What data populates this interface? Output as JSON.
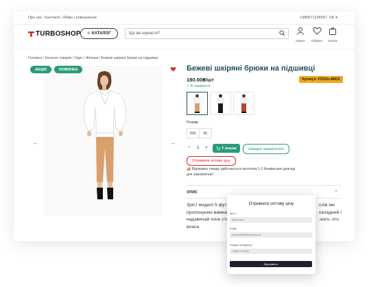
{
  "topbar": {
    "links": [
      "Про нас",
      "Контакти",
      "Обмін і повернення"
    ],
    "phone": "+380671234567",
    "lang": "UK"
  },
  "header": {
    "logo": "TURBOSHOP",
    "catalog_label": "КАТАЛОГ",
    "search_placeholder": "Що ви шукаєте?",
    "icons": [
      {
        "label": "Акаунт",
        "icon": "user-icon"
      },
      {
        "label": "Обране",
        "icon": "heart-icon",
        "count": "0"
      },
      {
        "label": "Кошик",
        "icon": "bag-icon",
        "count": "0"
      }
    ]
  },
  "breadcrumb": [
    "Головна",
    "Каталог товарів",
    "Одяг",
    "Жінкам",
    "Бежеві шкіряні брюки на підшивці"
  ],
  "badges": {
    "sale": "АКЦІЯ",
    "new": "НОВИНКА"
  },
  "colors": {
    "accent": "#2a9b7a",
    "title": "#21505b",
    "sale": "#2a9b7a",
    "red": "#d9231d",
    "article": "#f2a51a"
  },
  "product": {
    "title": "Бежеві шкіряні брюки на підшивці",
    "price": "180.00₴/шт",
    "article": "Артикул: FOXSs-48812",
    "stock": "✓ В наявності",
    "size_label": "Розмір",
    "sizes": [
      "XXL",
      "XL"
    ],
    "qty": "1",
    "cart_label": "У кошик",
    "quick_label": "Швидке замовлення",
    "wholesale_label": "Отримати оптову ціну",
    "shipping": "Відправка товару здійснюється протягом 1-2 банківських днів від дня замовлення!"
  },
  "description": {
    "heading": "ОПИС",
    "text": "Зріст моделі 5 футі пропонуємо вамна і водночас надзвичай хоче створити власн",
    "text_right": [
      "слів ми",
      "складний і",
      "-кого, хто"
    ]
  },
  "modal": {
    "title": "Отримати оптову ціну",
    "name_label": "Ім'я *",
    "name_value": "Борисович",
    "email_label": "Email",
    "email_value": "supermartin@turboshop.ua",
    "phone_label": "Номер телефону *",
    "phone_value": "+380671234567",
    "submit": "Відправити"
  }
}
